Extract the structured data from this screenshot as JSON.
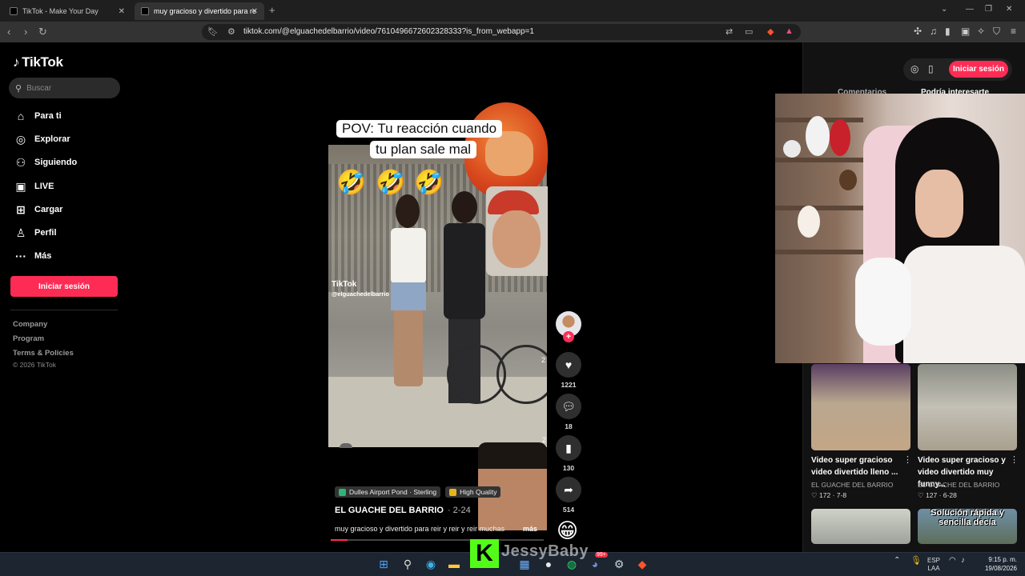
{
  "browser": {
    "tabs": [
      {
        "title": "TikTok - Make Your Day"
      },
      {
        "title": "muy gracioso y divertido para re"
      }
    ],
    "url": "tiktok.com/@elguachedelbarrio/video/7610496672602328333?is_from_webapp=1"
  },
  "sidebar": {
    "logo": "TikTok",
    "search_placeholder": "Buscar",
    "nav": [
      {
        "label": "Para ti",
        "icon": "home-icon"
      },
      {
        "label": "Explorar",
        "icon": "compass-icon"
      },
      {
        "label": "Siguiendo",
        "icon": "following-icon"
      },
      {
        "label": "LIVE",
        "icon": "live-icon"
      },
      {
        "label": "Cargar",
        "icon": "upload-icon"
      },
      {
        "label": "Perfil",
        "icon": "profile-icon"
      },
      {
        "label": "Más",
        "icon": "more-icon"
      }
    ],
    "login_button": "Iniciar sesión",
    "footer_links": [
      "Company",
      "Program",
      "Terms & Policies"
    ],
    "copyright": "© 2026 TikTok"
  },
  "video": {
    "caption_line1": "POV: Tu reacción cuando",
    "caption_line2": "tu plan sale mal",
    "emojis": "🤣",
    "watermark": "TikTok",
    "watermark_user": "@elguachedelbarrio",
    "side_numbers": [
      "2",
      "2"
    ],
    "progress": 0.08
  },
  "actions": {
    "likes": "1221",
    "comments": "18",
    "saves": "130",
    "shares": "514"
  },
  "info": {
    "tags": [
      {
        "label": "Dulles Airport Pond · Sterling",
        "color": "#2fb57a"
      },
      {
        "label": "High Quality",
        "color": "#e3b51e"
      }
    ],
    "author": "EL GUACHE DEL BARRIO",
    "date": "· 2-24",
    "description": "muy gracioso y divertido para reir y reir y reir muchas",
    "more": "más"
  },
  "right": {
    "login_button": "Iniciar sesión",
    "tab_comments": "Comentarios",
    "tab_related": "Podría interesarte",
    "videos": [
      {
        "title": "Video super gracioso video divertido lleno ...",
        "author": "EL GUACHE DEL BARRIO",
        "likes": "172",
        "date": "7-8"
      },
      {
        "title": "Video super gracioso y video divertido muy funny...",
        "author": "EL GUACHE DEL BARRIO",
        "likes": "127",
        "date": "6-28"
      }
    ],
    "thumb_text": "Solución rápida y sencilla decía"
  },
  "overlay": {
    "streamer_name": "JessyBaby",
    "kick_letter": "K"
  },
  "taskbar": {
    "lang_line1": "ESP",
    "lang_line2": "LAA",
    "time": "9:15 p. m.",
    "date": "19/08/2026",
    "badge": "99+"
  }
}
